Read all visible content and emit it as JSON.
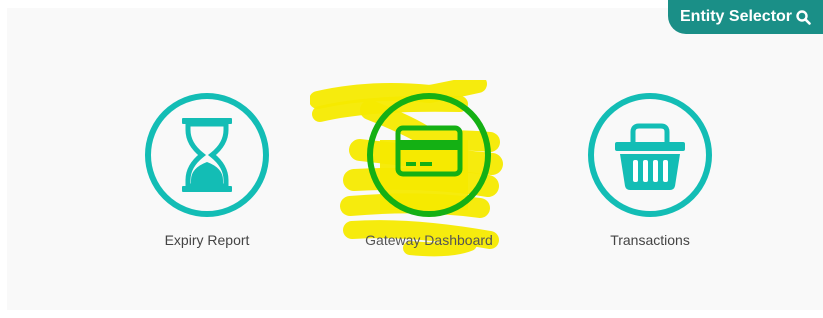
{
  "header": {
    "entity_selector_label": "Entity Selector"
  },
  "tiles": [
    {
      "label": "Expiry Report",
      "icon": "hourglass-icon"
    },
    {
      "label": "Gateway Dashboard",
      "icon": "credit-card-icon"
    },
    {
      "label": "Transactions",
      "icon": "shopping-basket-icon"
    }
  ],
  "colors": {
    "accent": "#13bdb5",
    "header_bg": "#1a8f87",
    "highlight": "#f5ea00",
    "highlighted_icon": "#14b014"
  }
}
